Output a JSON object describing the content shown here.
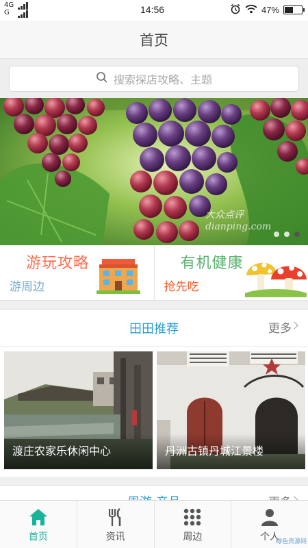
{
  "status_bar": {
    "network_line1": "4G",
    "network_line2": "G",
    "time": "14:56",
    "battery": "47%",
    "battery_level": 0.47,
    "icons": [
      "alarm-icon",
      "wifi-icon",
      "battery-icon"
    ]
  },
  "header": {
    "title": "首页"
  },
  "search": {
    "placeholder": "搜索探店攻略、主题"
  },
  "banner": {
    "watermark": "大众点评 dianping.com",
    "slide_count": 3,
    "active_slide": 3
  },
  "promos": [
    {
      "title": "游玩攻略",
      "subtitle": "游周边",
      "icon": "building-icon"
    },
    {
      "title": "有机健康",
      "subtitle": "抢先吃",
      "icon": "mushroom-icon"
    }
  ],
  "recommend": {
    "title": "田田推荐",
    "more": "更多",
    "items": [
      {
        "caption": "渡庄农家乐休闲中心"
      },
      {
        "caption": "丹洲古镇丹城江景楼"
      }
    ]
  },
  "nearby": {
    "title": "周游·产品",
    "more": "更多"
  },
  "tabbar": {
    "active_color": "#19b39a",
    "items": [
      {
        "label": "首页",
        "icon": "home-icon",
        "active": true
      },
      {
        "label": "资讯",
        "icon": "fork-knife-icon",
        "active": false
      },
      {
        "label": "周边",
        "icon": "grid-icon",
        "active": false
      },
      {
        "label": "个人",
        "icon": "person-icon",
        "active": false
      }
    ]
  },
  "corner_watermark": "绿色资源网"
}
